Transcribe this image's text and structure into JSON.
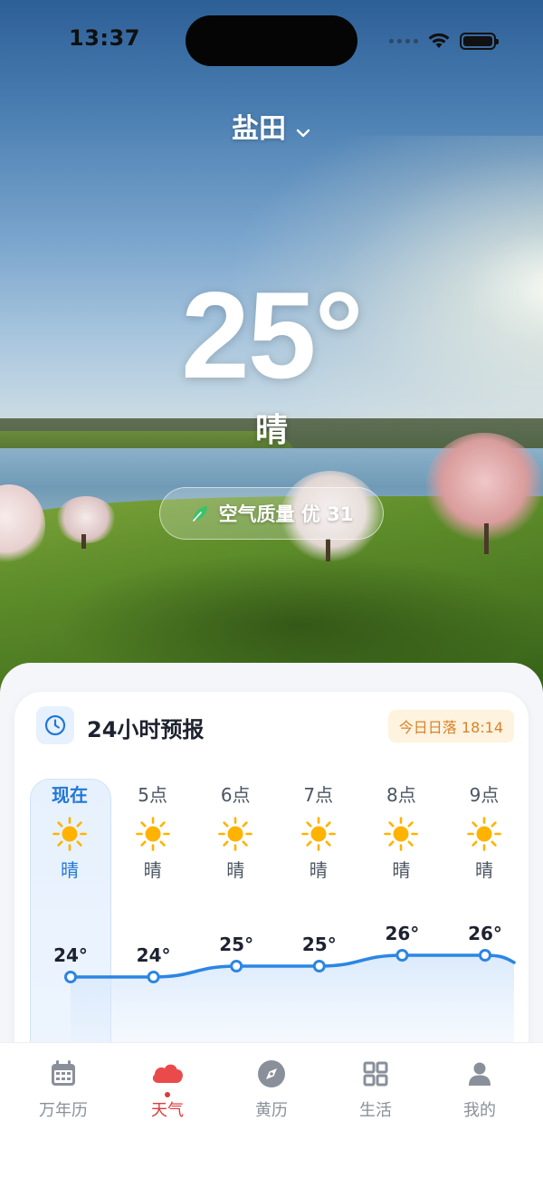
{
  "status_bar": {
    "time": "13:37"
  },
  "location": {
    "city": "盐田"
  },
  "current": {
    "temperature": "25°",
    "condition": "晴",
    "air_quality": "空气质量 优 31"
  },
  "forecast_card": {
    "title": "24小时预报",
    "sunset": "今日日落 18:14",
    "hours": [
      {
        "label": "现在",
        "condition": "晴",
        "icon": "sun-icon",
        "temp": 24
      },
      {
        "label": "5点",
        "condition": "晴",
        "icon": "sun-icon",
        "temp": 24
      },
      {
        "label": "6点",
        "condition": "晴",
        "icon": "sun-icon",
        "temp": 25
      },
      {
        "label": "7点",
        "condition": "晴",
        "icon": "sun-icon",
        "temp": 25
      },
      {
        "label": "8点",
        "condition": "晴",
        "icon": "sun-icon",
        "temp": 26
      },
      {
        "label": "9点",
        "condition": "晴",
        "icon": "sun-icon",
        "temp": 26
      }
    ]
  },
  "chart_data": {
    "type": "line",
    "categories": [
      "现在",
      "5点",
      "6点",
      "7点",
      "8点",
      "9点"
    ],
    "series": [
      {
        "values": [
          24,
          24,
          25,
          25,
          26,
          26
        ]
      }
    ],
    "unit": "°",
    "ylim": [
      22,
      27
    ],
    "grid": false
  },
  "tabbar": {
    "items": [
      {
        "label": "万年历",
        "icon": "calendar-icon"
      },
      {
        "label": "天气",
        "icon": "cloud-icon"
      },
      {
        "label": "黄历",
        "icon": "compass-icon"
      },
      {
        "label": "生活",
        "icon": "grid-icon"
      },
      {
        "label": "我的",
        "icon": "user-icon"
      }
    ],
    "active_index": 1
  },
  "colors": {
    "accent": "#2277d6",
    "active_tab": "#e03a3a",
    "sun": "#ffb300",
    "sunset_text": "#d9822b"
  }
}
